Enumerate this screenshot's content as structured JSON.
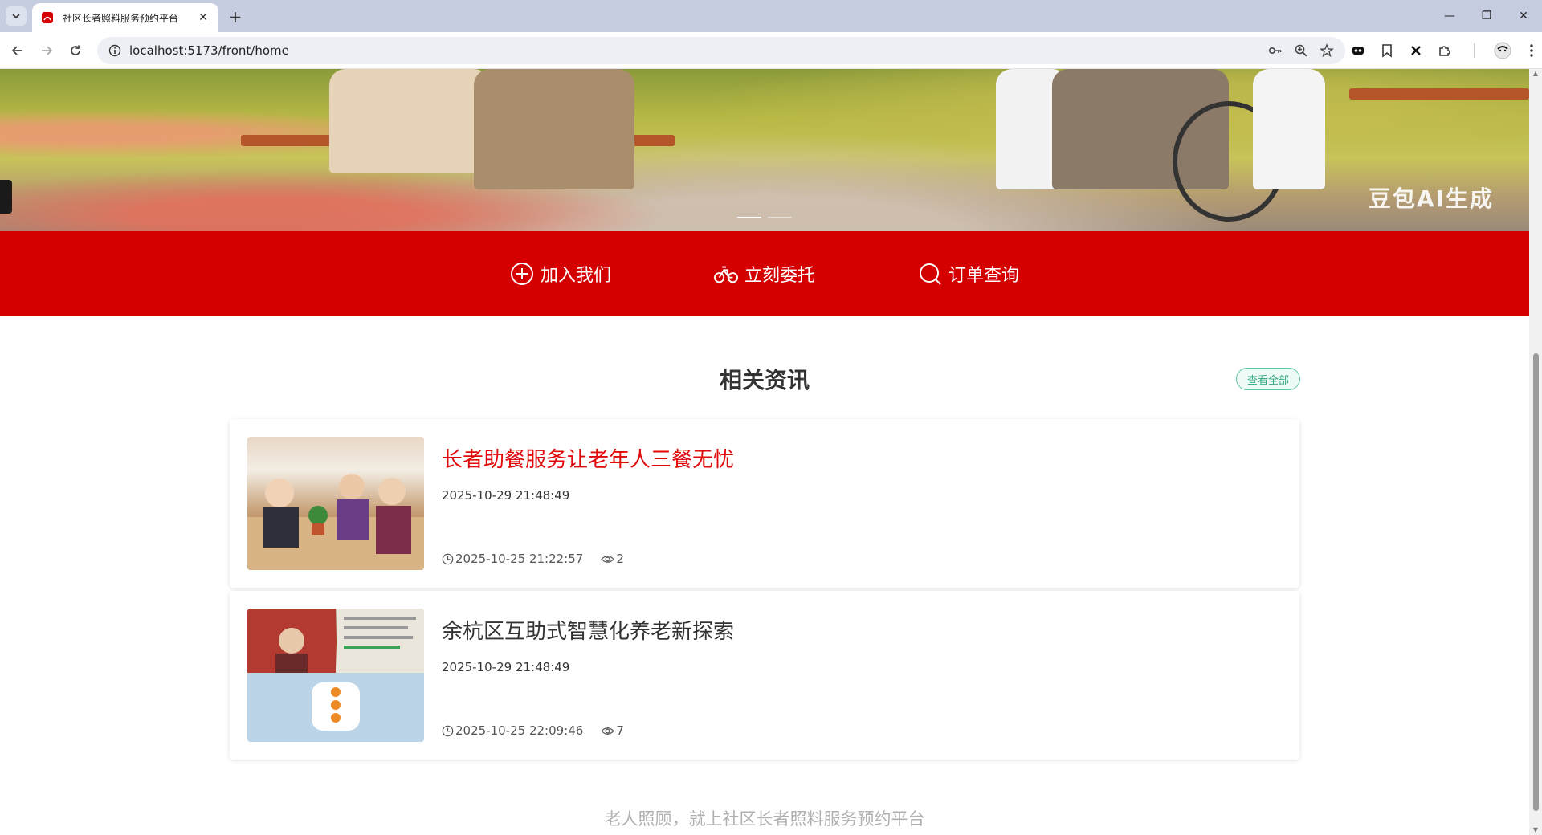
{
  "browser": {
    "tab_title": "社区长者照料服务预约平台",
    "url": "localhost:5173/front/home"
  },
  "banner": {
    "watermark": "豆包AI生成"
  },
  "actions": [
    {
      "label": "加入我们",
      "icon": "plus-circle-icon"
    },
    {
      "label": "立刻委托",
      "icon": "bicycle-icon"
    },
    {
      "label": "订单查询",
      "icon": "search-icon"
    }
  ],
  "news": {
    "title": "相关资讯",
    "view_all": "查看全部",
    "items": [
      {
        "title": "长者助餐服务让老年人三餐无忧",
        "subtitle": "2025-10-29 21:48:49",
        "time": "2025-10-25 21:22:57",
        "views": "2",
        "highlight": true
      },
      {
        "title": "余杭区互助式智慧化养老新探索",
        "subtitle": "2025-10-29 21:48:49",
        "time": "2025-10-25 22:09:46",
        "views": "7",
        "highlight": false
      }
    ]
  },
  "footer": {
    "slogan": "老人照顾，就上社区长者照料服务预约平台"
  },
  "colors": {
    "brand_red": "#d40000",
    "highlight_title": "#e10a0a",
    "accent_green": "#2fa77f"
  }
}
